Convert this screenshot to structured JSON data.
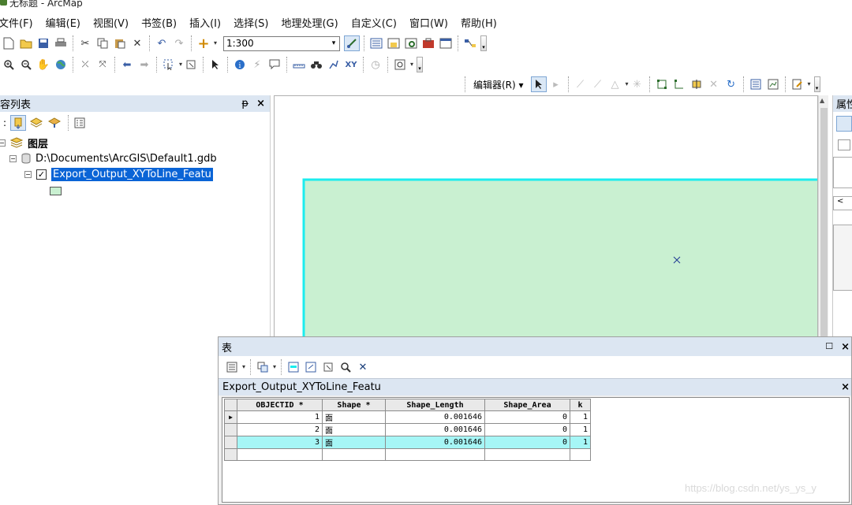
{
  "app": {
    "title": "无标题 - ArcMap"
  },
  "menubar": {
    "items": [
      "文件(F)",
      "编辑(E)",
      "视图(V)",
      "书签(B)",
      "插入(I)",
      "选择(S)",
      "地理处理(G)",
      "自定义(C)",
      "窗口(W)",
      "帮助(H)"
    ]
  },
  "toolbar": {
    "scale_value": "1:300"
  },
  "editor": {
    "label": "编辑器(R)"
  },
  "toc": {
    "title": "容列表",
    "root_label": "图层",
    "database_path": "D:\\Documents\\ArcGIS\\Default1.gdb",
    "layer_name": "Export_Output_XYToLine_Featu",
    "pin_symbol": "ᵽ",
    "close_symbol": "×"
  },
  "props": {
    "title": "属性"
  },
  "map": {
    "fill_color": "#c9f0d1",
    "outline_color": "#1cecee"
  },
  "table_window": {
    "title": "表",
    "tab_label": "Export_Output_XYToLine_Featu",
    "columns": [
      "OBJECTID *",
      "Shape *",
      "Shape_Length",
      "Shape_Area",
      "k"
    ],
    "rows": [
      {
        "objectid": "1",
        "shape": "面",
        "shape_length": "0.001646",
        "shape_area": "0",
        "k": "1"
      },
      {
        "objectid": "2",
        "shape": "面",
        "shape_length": "0.001646",
        "shape_area": "0",
        "k": "1"
      },
      {
        "objectid": "3",
        "shape": "面",
        "shape_length": "0.001646",
        "shape_area": "0",
        "k": "1"
      }
    ]
  },
  "watermark": "https://blog.csdn.net/ys_ys_y"
}
